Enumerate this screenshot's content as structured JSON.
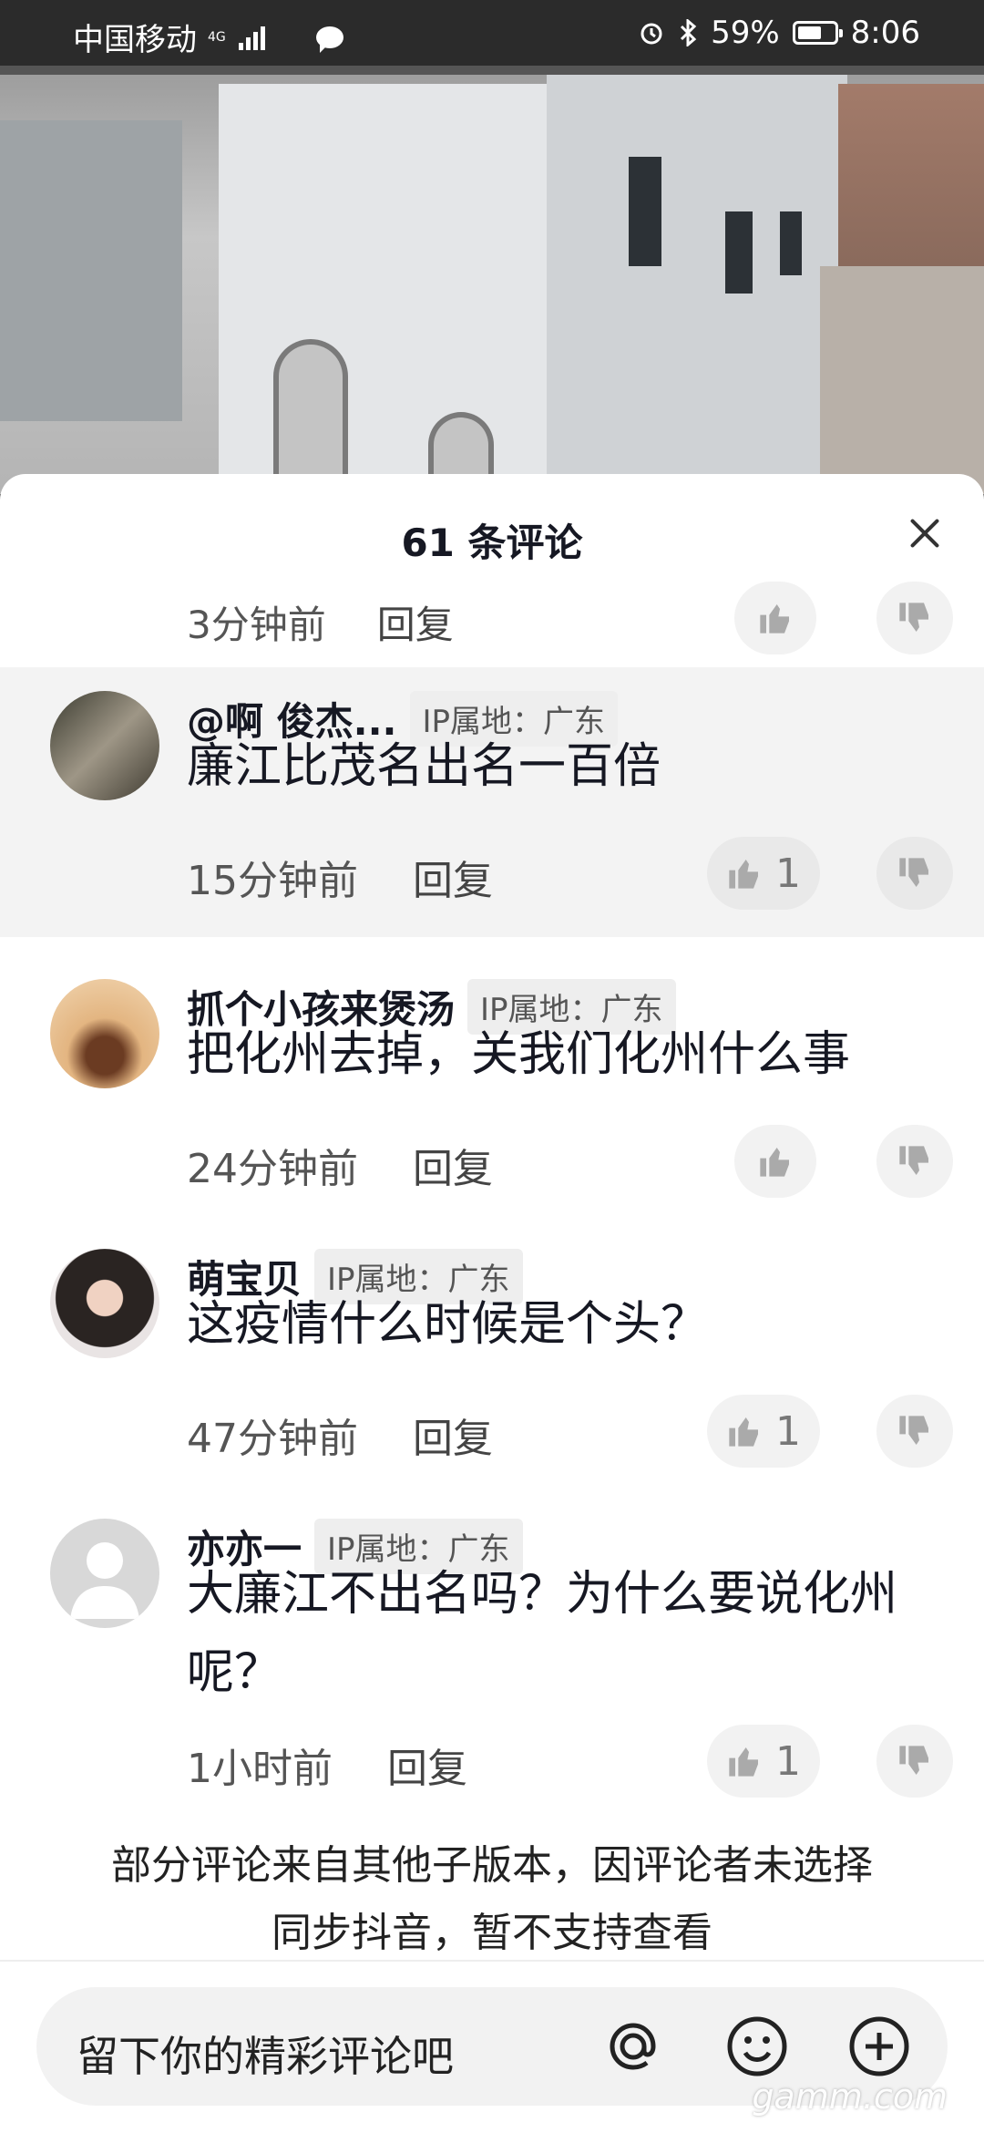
{
  "status_bar": {
    "carrier": "中国移动",
    "network": "4G",
    "battery": "59%",
    "battery_level": 0.59,
    "time": "8:06"
  },
  "sheet": {
    "title": "61 条评论",
    "close_icon": "close-icon"
  },
  "partial_comment": {
    "time": "3分钟前",
    "reply": "回复"
  },
  "comments": [
    {
      "name": "@啊 俊杰...",
      "ip": "IP属地：广东",
      "text": "廉江比茂名出名一百倍",
      "time": "15分钟前",
      "reply": "回复",
      "likes": "1"
    },
    {
      "name": "抓个小孩来煲汤",
      "ip": "IP属地：广东",
      "text": "把化州去掉，关我们化州什么事",
      "time": "24分钟前",
      "reply": "回复",
      "likes": ""
    },
    {
      "name": "萌宝贝",
      "ip": "IP属地：广东",
      "text": "这疫情什么时候是个头？",
      "time": "47分钟前",
      "reply": "回复",
      "likes": "1"
    },
    {
      "name": "亦亦一",
      "ip": "IP属地：广东",
      "text": "大廉江不出名吗？为什么要说化州呢？",
      "time": "1小时前",
      "reply": "回复",
      "likes": "1"
    }
  ],
  "notice": {
    "line1": "部分评论来自其他子版本，因评论者未选择",
    "line2": "同步抖音，暂不支持查看"
  },
  "input": {
    "placeholder": "留下你的精彩评论吧",
    "at_icon": "at-icon",
    "emoji_icon": "emoji-icon",
    "add_icon": "add-icon"
  },
  "watermark": "gamm.com",
  "colors": {
    "sheet_bg": "#ffffff",
    "highlight_bg": "#f3f3f3",
    "text_primary": "#161823"
  }
}
